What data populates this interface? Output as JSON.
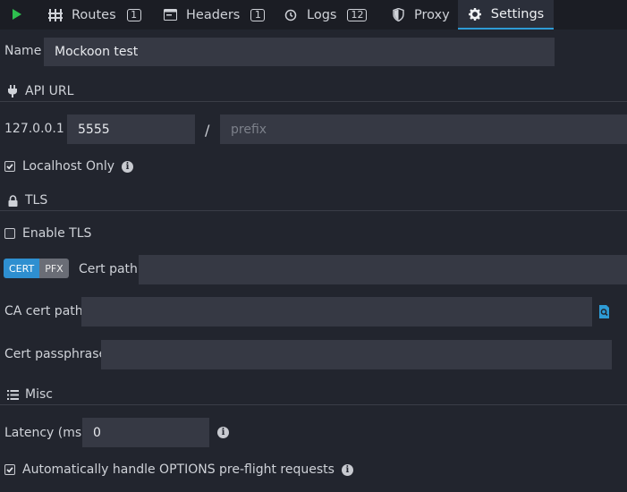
{
  "tabs": [
    {
      "label": "Routes",
      "badge": "1"
    },
    {
      "label": "Headers",
      "badge": "1"
    },
    {
      "label": "Logs",
      "badge": "12"
    },
    {
      "label": "Proxy"
    },
    {
      "label": "Settings"
    }
  ],
  "name": {
    "label": "Name",
    "value": "Mockoon test"
  },
  "api_url": {
    "section": "API URL",
    "host_label": "127.0.0.1 :",
    "port_value": "5555",
    "separator": "/",
    "prefix_placeholder": "prefix",
    "localhost_only": "Localhost Only"
  },
  "tls": {
    "section": "TLS",
    "enable_label": "Enable TLS",
    "cert_toggle": "CERT",
    "pfx_toggle": "PFX",
    "cert_path_label": "Cert path",
    "ca_cert_path_label": "CA cert path",
    "cert_passphrase_label": "Cert passphrase"
  },
  "misc": {
    "section": "Misc",
    "latency_label": "Latency (ms)",
    "latency_value": "0",
    "options_label": "Automatically handle OPTIONS pre-flight requests"
  },
  "colors": {
    "accent": "#2e9bd5",
    "play": "#2ebf4f",
    "background": "#22252e",
    "input": "#363944"
  }
}
